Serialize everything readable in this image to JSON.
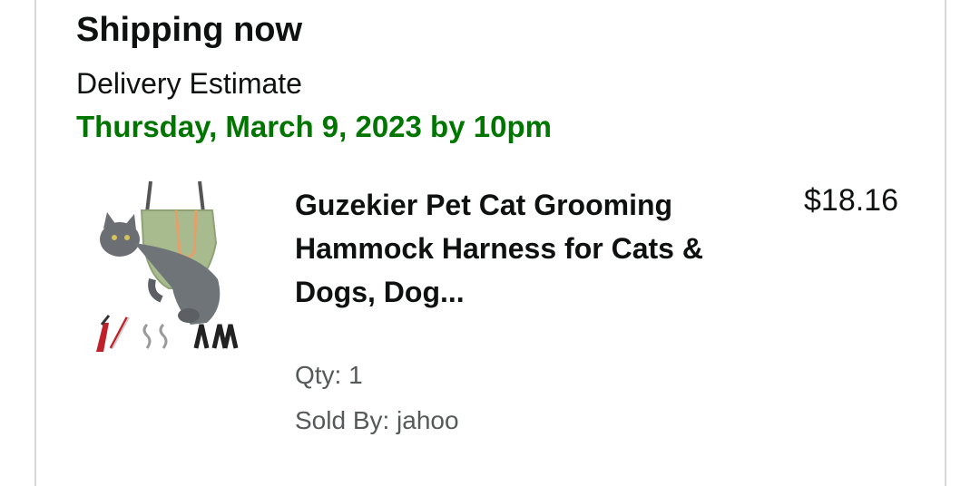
{
  "shipment": {
    "heading": "Shipping now",
    "delivery_label": "Delivery Estimate",
    "delivery_date": "Thursday, March 9, 2023 by 10pm",
    "delivery_color": "#007600"
  },
  "item": {
    "image_icon": "product-photo-cat-grooming-hammock",
    "title": "Guzekier Pet Cat Grooming Hammock Harness for Cats & Dogs, Dog...",
    "price": "$18.16",
    "qty": "Qty: 1",
    "seller": "Sold By: jahoo"
  }
}
